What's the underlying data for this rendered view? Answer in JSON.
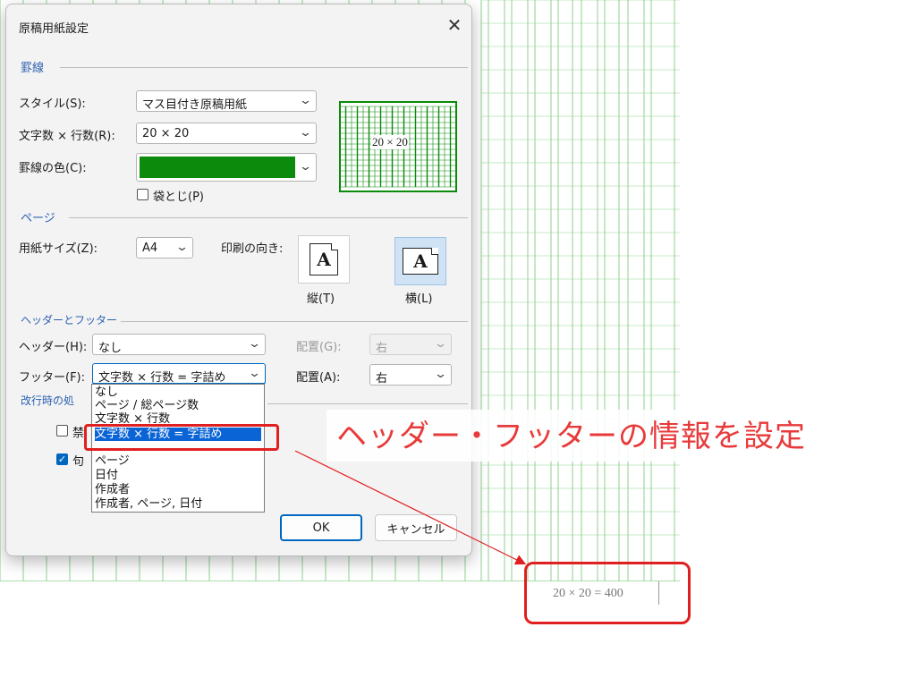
{
  "dialog": {
    "title": "原稿用紙設定",
    "close_icon": "close-icon",
    "sections": {
      "ruled_lines": "罫線",
      "page": "ページ",
      "header_footer": "ヘッダーとフッター",
      "line_break": "改行時の処"
    },
    "style_label": "スタイル(S):",
    "style_value": "マス目付き原稿用紙",
    "grid_label": "文字数 × 行数(R):",
    "grid_value": "20 × 20",
    "line_color_label": "罫線の色(C):",
    "line_color": "#0b8a0b",
    "fukuro_label": "袋とじ(P)",
    "preview_label": "20 × 20",
    "paper_size_label": "用紙サイズ(Z):",
    "paper_size_value": "A4",
    "orientation_label": "印刷の向き:",
    "portrait_label": "縦(T)",
    "landscape_label": "横(L)",
    "header_label": "ヘッダー(H):",
    "header_value": "なし",
    "header_align_label": "配置(G):",
    "header_align_value": "右",
    "footer_label": "フッター(F):",
    "footer_value": "文字数 × 行数 = 字詰め",
    "footer_align_label": "配置(A):",
    "footer_align_value": "右",
    "kinsoku_partial": "禁",
    "kutouten_partial": "句",
    "ok_label": "OK",
    "cancel_label": "キャンセル"
  },
  "footer_options": [
    "なし",
    "ページ / 総ページ数",
    "文字数 × 行数",
    "文字数 × 行数 = 字詰め",
    "ページ",
    "日付",
    "作成者",
    "作成者, ページ, 日付"
  ],
  "footer_selected_index": 3,
  "annotation": "ヘッダー・フッターの情報を設定",
  "paper_footer_text": "20 × 20 = 400",
  "colors": {
    "accent": "#0067c0",
    "annotation": "#e83a3a",
    "grid": "#8fd18f"
  }
}
